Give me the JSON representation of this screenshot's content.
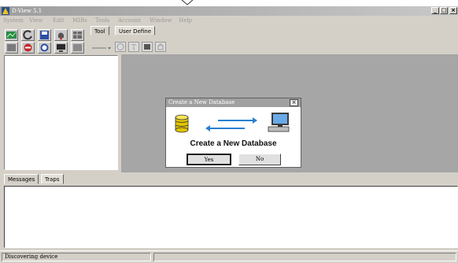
{
  "window": {
    "title": "D-View 5.1",
    "controls": [
      "_",
      "□",
      "×"
    ]
  },
  "menubar": {
    "items": [
      "System",
      "View",
      "Edit",
      "MIBs",
      "Tools",
      "Account",
      "Window",
      "Help"
    ]
  },
  "toolbar": {
    "tabs": [
      "Tool",
      "User Define"
    ],
    "active_tab": "Tool",
    "icons_row1": [
      "topology-icon",
      "refresh-icon",
      "save-icon",
      "bell-icon",
      "grid-icon"
    ],
    "icons_row2": [
      "device-list-icon",
      "stop-icon",
      "clock-icon",
      "monitor-icon",
      "disabled-icon"
    ],
    "draw_tools": [
      "line-tool-icon",
      "ellipse-tool-icon",
      "text-tool-icon",
      "image-tool-icon",
      "hand-tool-icon"
    ]
  },
  "dialog": {
    "title": "Create a New Database",
    "close_label": "×",
    "heading": "Create a New Database",
    "yes_label": "Yes",
    "no_label": "No"
  },
  "bottom_panel": {
    "tabs": [
      "Messages",
      "Traps"
    ],
    "active_tab": "Messages"
  },
  "statusbar": {
    "text": "Discovering device"
  },
  "colors": {
    "face": "#d4d0c8",
    "canvas": "#a6a6a6",
    "titlebar": "#9e9e9e"
  }
}
